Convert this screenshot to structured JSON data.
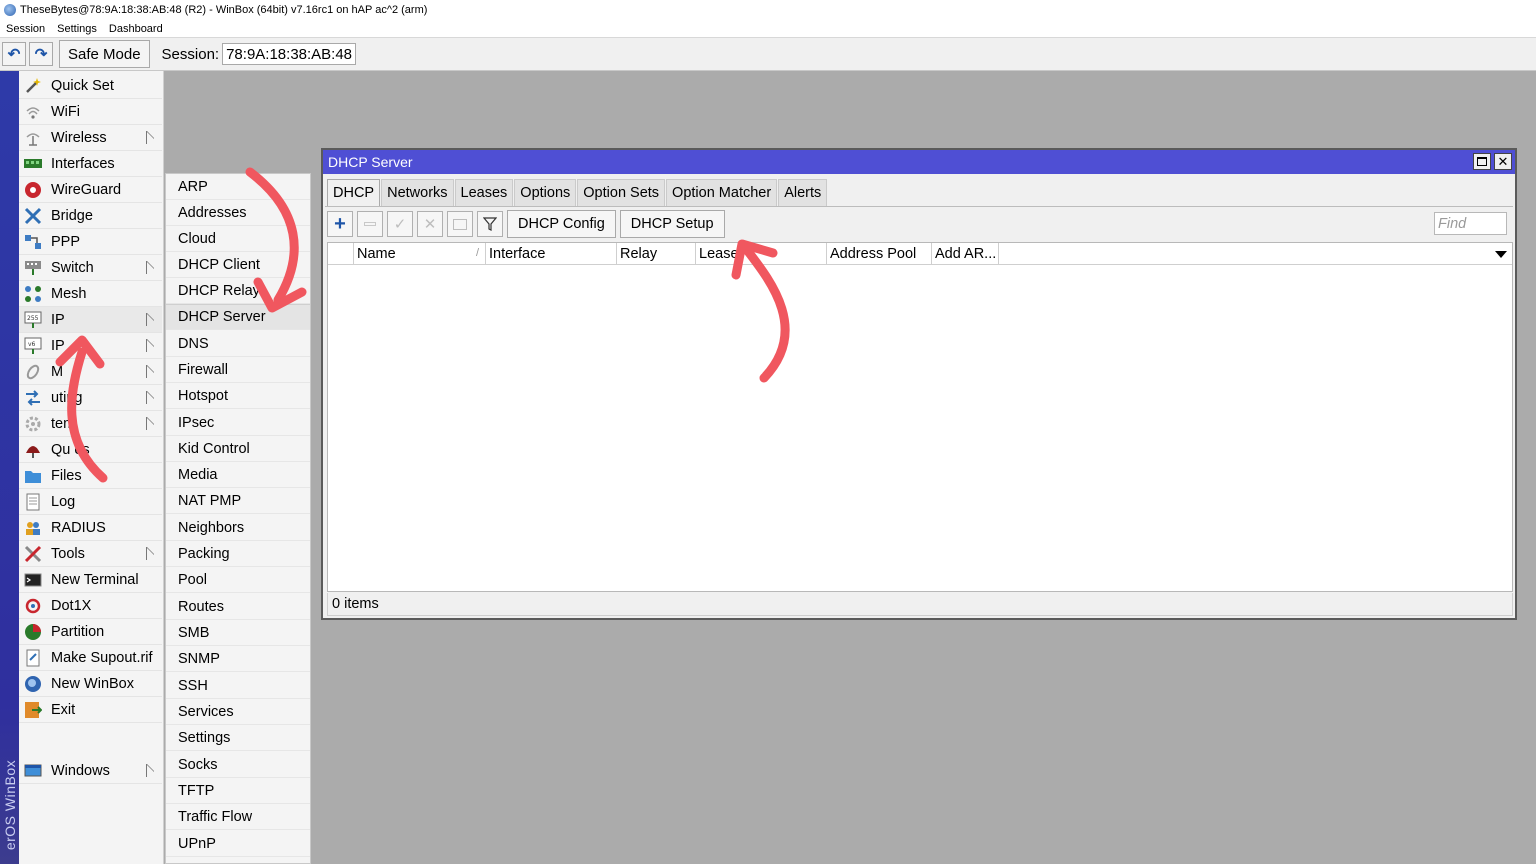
{
  "window": {
    "title": "TheseBytes@78:9A:18:38:AB:48 (R2) - WinBox (64bit) v7.16rc1 on hAP ac^2 (arm)",
    "menus": [
      "Session",
      "Settings",
      "Dashboard"
    ]
  },
  "toolbar": {
    "undo_icon": "undo-icon",
    "redo_icon": "redo-icon",
    "safe_mode_label": "Safe Mode",
    "session_label": "Session:",
    "session_value": "78:9A:18:38:AB:48"
  },
  "brand": {
    "vertical_text": "RouterOS WinBox",
    "visible_text": "erOS WinBox"
  },
  "main_menu": {
    "items": [
      {
        "label": "Quick Set",
        "icon": "wand-icon"
      },
      {
        "label": "WiFi",
        "icon": "wifi-icon"
      },
      {
        "label": "Wireless",
        "icon": "antenna-icon"
      },
      {
        "label": "Interfaces",
        "icon": "interfaces-icon"
      },
      {
        "label": "WireGuard",
        "icon": "wireguard-icon"
      },
      {
        "label": "Bridge",
        "icon": "bridge-icon"
      },
      {
        "label": "PPP",
        "icon": "ppp-icon"
      },
      {
        "label": "Switch",
        "icon": "switch-icon"
      },
      {
        "label": "Mesh",
        "icon": "mesh-icon"
      },
      {
        "label": "IP",
        "icon": "ip-icon"
      },
      {
        "label": "IP",
        "icon": "ipv6-icon"
      },
      {
        "label": "M",
        "icon": "mpls-icon"
      },
      {
        "label": "uting",
        "icon": "routing-icon"
      },
      {
        "label": "tem",
        "icon": "system-icon"
      },
      {
        "label": "Qu es",
        "icon": "queues-icon"
      },
      {
        "label": "Files",
        "icon": "folder-icon"
      },
      {
        "label": "Log",
        "icon": "log-icon"
      },
      {
        "label": "RADIUS",
        "icon": "radius-icon"
      },
      {
        "label": "Tools",
        "icon": "tools-icon"
      },
      {
        "label": "New Terminal",
        "icon": "terminal-icon"
      },
      {
        "label": "Dot1X",
        "icon": "dot1x-icon"
      },
      {
        "label": "Partition",
        "icon": "partition-icon"
      },
      {
        "label": "Make Supout.rif",
        "icon": "supout-icon"
      },
      {
        "label": "New WinBox",
        "icon": "winbox-icon"
      },
      {
        "label": "Exit",
        "icon": "exit-icon"
      },
      {
        "label": "Windows",
        "icon": "windows-icon"
      }
    ]
  },
  "ip_submenu": {
    "items": [
      "ARP",
      "Addresses",
      "Cloud",
      "DHCP Client",
      "DHCP Relay",
      "DHCP Server",
      "DNS",
      "Firewall",
      "Hotspot",
      "IPsec",
      "Kid Control",
      "Media",
      "NAT PMP",
      "Neighbors",
      "Packing",
      "Pool",
      "Routes",
      "SMB",
      "SNMP",
      "SSH",
      "Services",
      "Settings",
      "Socks",
      "TFTP",
      "Traffic Flow",
      "UPnP"
    ],
    "selected": "DHCP Server"
  },
  "dhcp_window": {
    "title": "DHCP Server",
    "tabs": [
      "DHCP",
      "Networks",
      "Leases",
      "Options",
      "Option Sets",
      "Option Matcher",
      "Alerts"
    ],
    "active_tab": "DHCP",
    "buttons": {
      "dhcp_config": "DHCP Config",
      "dhcp_setup": "DHCP Setup"
    },
    "find_placeholder": "Find",
    "columns": [
      "Name",
      "Interface",
      "Relay",
      "Lease",
      "Address Pool",
      "Add AR..."
    ],
    "status": "0 items"
  },
  "colors": {
    "window_title_bg": "#4f4fd4",
    "brand_band": "#2e3aa8",
    "annotation_arrow": "#f0575f",
    "add_button": "#1e55a8"
  }
}
